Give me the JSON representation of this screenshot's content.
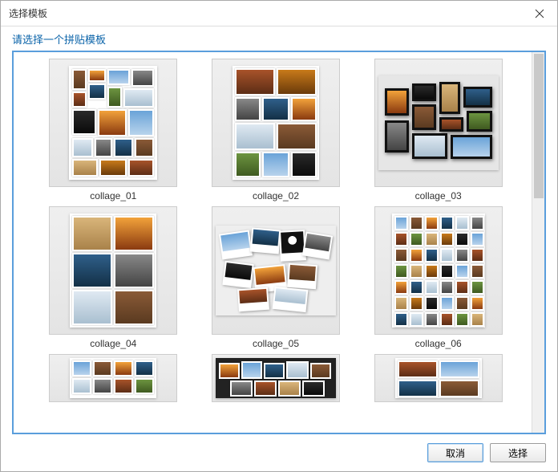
{
  "window": {
    "title": "选择模板"
  },
  "header": {
    "prompt": "请选择一个拼贴模板"
  },
  "templates": [
    {
      "label": "collage_01"
    },
    {
      "label": "collage_02"
    },
    {
      "label": "collage_03"
    },
    {
      "label": "collage_04"
    },
    {
      "label": "collage_05"
    },
    {
      "label": "collage_06"
    }
  ],
  "buttons": {
    "cancel": "取消",
    "select": "选择"
  }
}
